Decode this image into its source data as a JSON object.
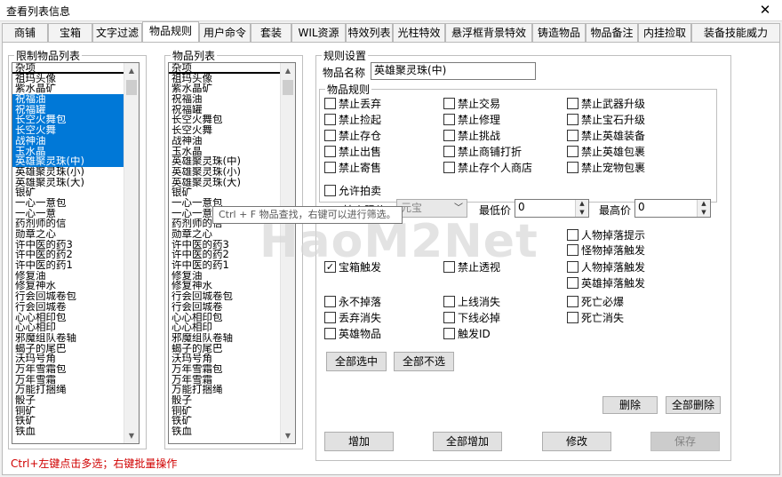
{
  "window": {
    "title": "查看列表信息",
    "close_glyph": "✕"
  },
  "tabs": [
    "商铺",
    "宝箱",
    "文字过滤",
    "物品规则",
    "用户命令",
    "套装",
    "WIL资源",
    "特效列表",
    "光柱特效",
    "悬浮框背景特效",
    "铸造物品",
    "物品备注",
    "内挂捡取",
    "装备技能威力"
  ],
  "left_list": {
    "legend": "限制物品列表",
    "items": [
      {
        "t": "杂项",
        "sel": false
      },
      {
        "t": "祖玛头像",
        "sel": false
      },
      {
        "t": "紫水晶矿",
        "sel": false
      },
      {
        "t": "祝福油",
        "sel": true
      },
      {
        "t": "祝福罐",
        "sel": true
      },
      {
        "t": "长空火舞包",
        "sel": true
      },
      {
        "t": "长空火舞",
        "sel": true
      },
      {
        "t": "战神油",
        "sel": true
      },
      {
        "t": "玉水晶",
        "sel": true
      },
      {
        "t": "英雄聚灵珠(中)",
        "sel": true
      },
      {
        "t": "英雄聚灵珠(小)",
        "sel": false
      },
      {
        "t": "英雄聚灵珠(大)",
        "sel": false
      },
      {
        "t": "银矿",
        "sel": false
      },
      {
        "t": "一心一意包",
        "sel": false
      },
      {
        "t": "一心一意",
        "sel": false
      },
      {
        "t": "药剂师的信",
        "sel": false
      },
      {
        "t": "勋章之心",
        "sel": false
      },
      {
        "t": "许中医的药3",
        "sel": false
      },
      {
        "t": "许中医的药2",
        "sel": false
      },
      {
        "t": "许中医的药1",
        "sel": false
      },
      {
        "t": "修复油",
        "sel": false
      },
      {
        "t": "修复神水",
        "sel": false
      },
      {
        "t": "行会回城卷包",
        "sel": false
      },
      {
        "t": "行会回城卷",
        "sel": false
      },
      {
        "t": "心心相印包",
        "sel": false
      },
      {
        "t": "心心相印",
        "sel": false
      },
      {
        "t": "邪魔组队卷轴",
        "sel": false
      },
      {
        "t": "蝎子的尾巴",
        "sel": false
      },
      {
        "t": "沃玛号角",
        "sel": false
      },
      {
        "t": "万年雪霜包",
        "sel": false
      },
      {
        "t": "万年雪霜",
        "sel": false
      },
      {
        "t": "万能打捆绳",
        "sel": false
      },
      {
        "t": "骰子",
        "sel": false
      },
      {
        "t": "铜矿",
        "sel": false
      },
      {
        "t": "铁矿",
        "sel": false
      },
      {
        "t": "铁血",
        "sel": false
      }
    ]
  },
  "right_list": {
    "legend": "物品列表",
    "items": [
      "杂项",
      "祖玛头像",
      "紫水晶矿",
      "祝福油",
      "祝福罐",
      "长空火舞包",
      "长空火舞",
      "战神油",
      "玉水晶",
      "英雄聚灵珠(中)",
      "英雄聚灵珠(小)",
      "英雄聚灵珠(大)",
      "银矿",
      "一心一意包",
      "一心一意",
      "药剂师的信",
      "勋章之心",
      "许中医的药3",
      "许中医的药2",
      "许中医的药1",
      "修复油",
      "修复神水",
      "行会回城卷包",
      "行会回城卷",
      "心心相印包",
      "心心相印",
      "邪魔组队卷轴",
      "蝎子的尾巴",
      "沃玛号角",
      "万年雪霜包",
      "万年雪霜",
      "万能打捆绳",
      "骰子",
      "铜矿",
      "铁矿",
      "铁血"
    ]
  },
  "settings": {
    "legend": "规则设置",
    "name_label": "物品名称",
    "name_value": "英雄聚灵珠(中)",
    "rules_legend": "物品规则",
    "rules": [
      {
        "t": "禁止丢弃",
        "c": false
      },
      {
        "t": "禁止交易",
        "c": false
      },
      {
        "t": "禁止武器升级",
        "c": false
      },
      {
        "t": "禁止捡起",
        "c": false
      },
      {
        "t": "禁止修理",
        "c": false
      },
      {
        "t": "禁止宝石升级",
        "c": false
      },
      {
        "t": "禁止存仓",
        "c": false
      },
      {
        "t": "禁止挑战",
        "c": false
      },
      {
        "t": "禁止英雄装备",
        "c": false
      },
      {
        "t": "禁止出售",
        "c": false
      },
      {
        "t": "禁止商铺打折",
        "c": false
      },
      {
        "t": "禁止英雄包裹",
        "c": false
      },
      {
        "t": "禁止寄售",
        "c": false
      },
      {
        "t": "禁止存个人商店",
        "c": false
      },
      {
        "t": "禁止宠物包裹",
        "c": false
      }
    ],
    "allow_auction": "允许拍卖",
    "auction_price_label": "拍卖限价",
    "currency_value": "元宝",
    "min_price_label": "最低价",
    "min_price": "0",
    "max_price_label": "最高价",
    "max_price": "0",
    "drop_rules": [
      {
        "t": "人物掉落提示",
        "c": false
      },
      {
        "t": "怪物掉落触发",
        "c": false
      },
      {
        "t": "宝箱触发",
        "c": true
      },
      {
        "t": "禁止透视",
        "c": false
      },
      {
        "t": "人物掉落触发",
        "c": false
      },
      {
        "t": "英雄掉落触发",
        "c": false
      }
    ],
    "misc": [
      {
        "t": "永不掉落",
        "c": false
      },
      {
        "t": "上线消失",
        "c": false
      },
      {
        "t": "死亡必爆",
        "c": false
      },
      {
        "t": "丢弃消失",
        "c": false
      },
      {
        "t": "下线必掉",
        "c": false
      },
      {
        "t": "死亡消失",
        "c": false
      },
      {
        "t": "英雄物品",
        "c": false
      },
      {
        "t": "触发ID",
        "c": false
      }
    ],
    "select_all": "全部选中",
    "select_none": "全部不选",
    "delete": "删除",
    "delete_all": "全部删除",
    "add": "增加",
    "add_all": "全部增加",
    "modify": "修改",
    "save": "保存"
  },
  "tooltip": "Ctrl + F 物品查找，右键可以进行筛选。",
  "watermark": "HaoM2Net",
  "status": "Ctrl+左键点击多选；右键批量操作",
  "colors": {
    "selection": "#0078d7",
    "status_text": "#d00000"
  }
}
